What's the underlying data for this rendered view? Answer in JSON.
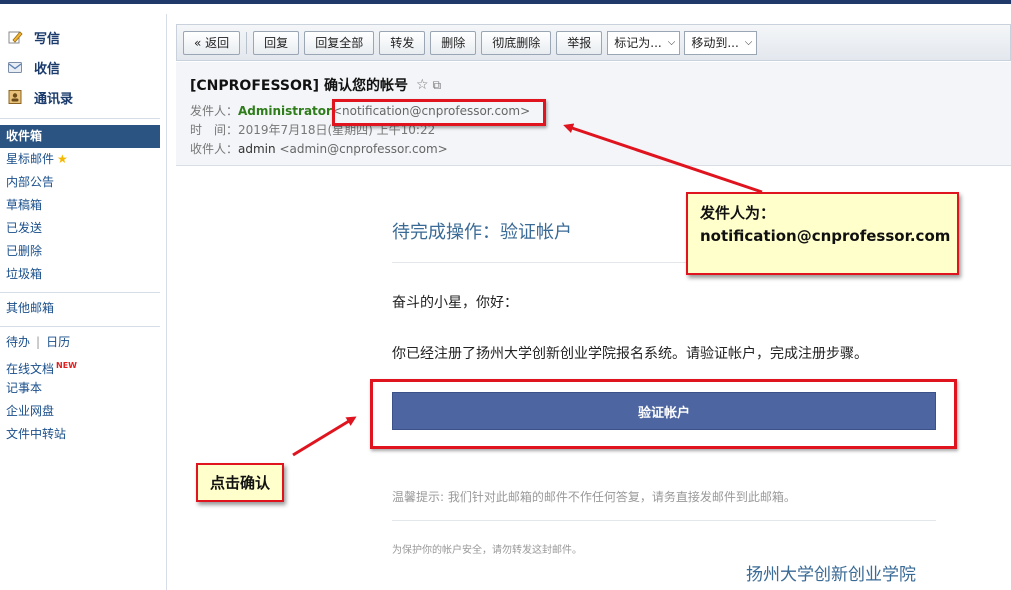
{
  "sidebar": {
    "quick": [
      {
        "label": "写信",
        "icon": "pencil-icon"
      },
      {
        "label": "收信",
        "icon": "inbox-icon"
      },
      {
        "label": "通讯录",
        "icon": "address-book-icon"
      }
    ],
    "folders": {
      "inbox": "收件箱",
      "starred": "星标邮件",
      "announce": "内部公告",
      "drafts": "草稿箱",
      "sent": "已发送",
      "deleted": "已删除",
      "spam": "垃圾箱",
      "other": "其他邮箱",
      "todo": "待办",
      "calendar": "日历",
      "docs": "在线文档",
      "new_tag": "NEW",
      "notes": "记事本",
      "netdisk": "企业网盘",
      "transfer": "文件中转站"
    }
  },
  "toolbar": {
    "back": "« 返回",
    "reply": "回复",
    "reply_all": "回复全部",
    "forward": "转发",
    "delete": "删除",
    "delete_perm": "彻底删除",
    "report": "举报",
    "mark_as": "标记为...",
    "move_to": "移动到..."
  },
  "header": {
    "subject": "[CNPROFESSOR] 确认您的帐号",
    "from_label": "发件人：",
    "from_name": "Administrator",
    "from_addr": "<notification@cnprofessor.com>",
    "time_label": "时　间：",
    "time_value": "2019年7月18日(星期四) 上午10:22",
    "to_label": "收件人：",
    "to_name": "admin",
    "to_addr": "<admin@cnprofessor.com>"
  },
  "body": {
    "title": "待完成操作：验证帐户",
    "greeting": "奋斗的小星，你好：",
    "paragraph": "你已经注册了扬州大学创新创业学院报名系统。请验证帐户，完成注册步骤。",
    "verify_button": "验证帐户",
    "tip": "温馨提示: 我们针对此邮箱的邮件不作任何答复，请务直接发邮件到此邮箱。",
    "security_note": "为保护你的帐户安全，请勿转发这封邮件。",
    "signature": "扬州大学创新创业学院"
  },
  "annotations": {
    "sender_callout_line1": "发件人为：",
    "sender_callout_line2": "notification@cnprofessor.com",
    "click_callout": "点击确认"
  },
  "colors": {
    "highlight": "#e0141e",
    "callout_bg": "#ffffcc",
    "button_bg": "#4d65a0"
  }
}
